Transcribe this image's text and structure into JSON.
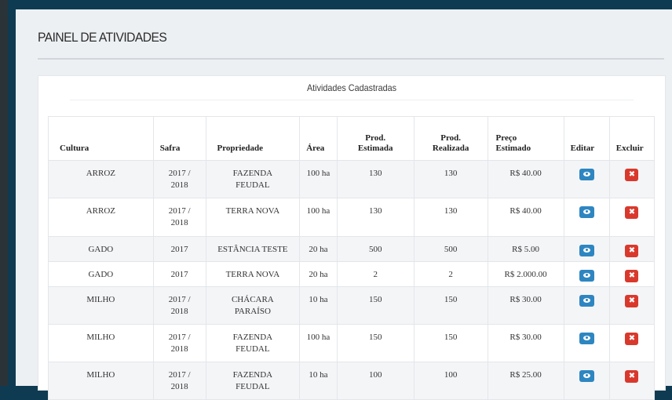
{
  "page": {
    "title": "PAINEL DE ATIVIDADES"
  },
  "panel": {
    "heading": "Atividades Cadastradas"
  },
  "table": {
    "headers": {
      "cultura": "Cultura",
      "safra": "Safra",
      "propriedade": "Propriedade",
      "area": "Área",
      "prod_estimada_1": "Prod.",
      "prod_estimada_2": "Estimada",
      "prod_realizada_1": "Prod.",
      "prod_realizada_2": "Realizada",
      "preco_1": "Preço",
      "preco_2": "Estimado",
      "editar": "Editar",
      "excluir": "Excluir"
    },
    "rows": [
      {
        "cultura": "ARROZ",
        "safra_1": "2017 /",
        "safra_2": "2018",
        "prop_1": "FAZENDA",
        "prop_2": "FEUDAL",
        "area": "100 ha",
        "estimada": "130",
        "realizada": "130",
        "preco": "R$ 40.00"
      },
      {
        "cultura": "ARROZ",
        "safra_1": "2017 /",
        "safra_2": "2018",
        "prop_1": "TERRA NOVA",
        "prop_2": "",
        "area": "100 ha",
        "estimada": "130",
        "realizada": "130",
        "preco": "R$ 40.00"
      },
      {
        "cultura": "GADO",
        "safra_1": "2017",
        "safra_2": "",
        "prop_1": "ESTÂNCIA TESTE",
        "prop_2": "",
        "area": "20 ha",
        "estimada": "500",
        "realizada": "500",
        "preco": "R$ 5.00"
      },
      {
        "cultura": "GADO",
        "safra_1": "2017",
        "safra_2": "",
        "prop_1": "TERRA NOVA",
        "prop_2": "",
        "area": "20 ha",
        "estimada": "2",
        "realizada": "2",
        "preco": "R$ 2.000.00"
      },
      {
        "cultura": "MILHO",
        "safra_1": "2017 /",
        "safra_2": "2018",
        "prop_1": "CHÁCARA",
        "prop_2": "PARAÍSO",
        "area": "10 ha",
        "estimada": "150",
        "realizada": "150",
        "preco": "R$ 30.00"
      },
      {
        "cultura": "MILHO",
        "safra_1": "2017 /",
        "safra_2": "2018",
        "prop_1": "FAZENDA",
        "prop_2": "FEUDAL",
        "area": "100 ha",
        "estimada": "150",
        "realizada": "150",
        "preco": "R$ 30.00"
      },
      {
        "cultura": "MILHO",
        "safra_1": "2017 /",
        "safra_2": "2018",
        "prop_1": "FAZENDA",
        "prop_2": "FEUDAL",
        "area": "10 ha",
        "estimada": "100",
        "realizada": "100",
        "preco": "R$ 25.00"
      }
    ]
  },
  "icons": {
    "edit": "eye-icon",
    "delete": "close-icon"
  },
  "colors": {
    "edit_button": "#2e86c1",
    "delete_button": "#d9392c",
    "background": "#0f3b52"
  }
}
